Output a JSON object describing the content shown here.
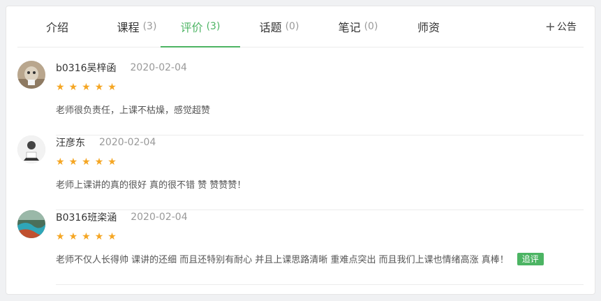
{
  "tabs": [
    {
      "label": "介绍",
      "count": ""
    },
    {
      "label": "课程",
      "count": "(3)"
    },
    {
      "label": "评价",
      "count": "(3)"
    },
    {
      "label": "话题",
      "count": "(0)"
    },
    {
      "label": "笔记",
      "count": "(0)"
    },
    {
      "label": "师资",
      "count": ""
    }
  ],
  "active_tab": "评价",
  "notice": {
    "plus": "+",
    "label": "公告"
  },
  "reviews": [
    {
      "user": "b0316吴梓函",
      "date": "2020-02-04",
      "rating": 5,
      "text": "老师很负责任，上课不枯燥，感觉超赞"
    },
    {
      "user": "汪彦东",
      "date": "2020-02-04",
      "rating": 5,
      "text": "老师上课讲的真的很好 真的很不错 赞 赞赞赞！"
    },
    {
      "user": "B0316班栥涵",
      "date": "2020-02-04",
      "rating": 5,
      "text": "老师不仅人长得帅 课讲的还细 而且还特别有耐心 并且上课思路清晰 重难点突出 而且我们上课也情绪高涨 真棒！",
      "badge": "追评"
    }
  ],
  "colors": {
    "accent": "#4cb463",
    "star": "#f5a623"
  }
}
